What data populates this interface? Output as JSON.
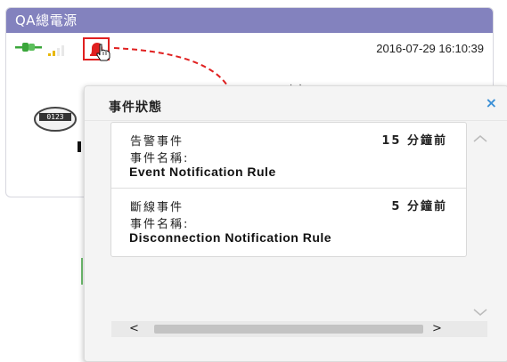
{
  "device_card": {
    "title": "QA總電源",
    "timestamp": "2016-07-29 16:10:39",
    "power_label": "功率",
    "meter_readout": "0123",
    "icons": [
      "plug-icon",
      "signal-icon",
      "alarm-bell-icon",
      "hand-cursor-icon",
      "meter-icon"
    ],
    "colors": {
      "header": "#8382be",
      "alarm": "#e02020",
      "plug": "#3aa63a",
      "signal": "#e8b800"
    }
  },
  "event_panel": {
    "title": "事件狀態",
    "close_label": "×",
    "events": [
      {
        "type": "告警事件",
        "time_ago": "15 分鐘前",
        "name_label": "事件名稱:",
        "rule": "Event Notification Rule"
      },
      {
        "type": "斷線事件",
        "time_ago": "5 分鐘前",
        "name_label": "事件名稱:",
        "rule": "Disconnection Notification Rule"
      }
    ],
    "scroll": {
      "left_label": "<",
      "right_label": ">"
    }
  }
}
